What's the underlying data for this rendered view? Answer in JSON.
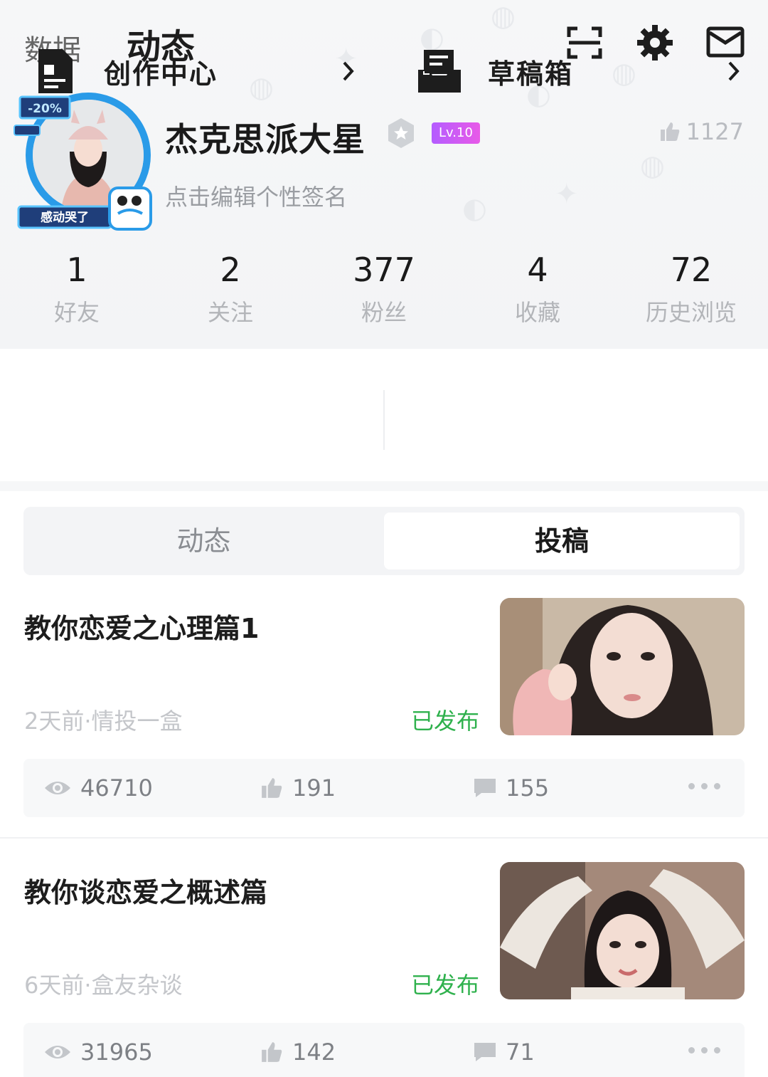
{
  "header": {
    "tab_data": "数据",
    "tab_dynamic": "动态",
    "icons": [
      "scan-icon",
      "settings-icon",
      "mail-icon"
    ]
  },
  "profile": {
    "avatar_badge_top": "-20%",
    "avatar_badge_bottom": "感动哭了",
    "username": "杰克思派大星",
    "level": "Lv.10",
    "likes_total": "1127",
    "signature": "点击编辑个性签名"
  },
  "stats": [
    {
      "value": "1",
      "label": "好友"
    },
    {
      "value": "2",
      "label": "关注"
    },
    {
      "value": "377",
      "label": "粉丝"
    },
    {
      "value": "4",
      "label": "收藏"
    },
    {
      "value": "72",
      "label": "历史浏览"
    }
  ],
  "quick_links": {
    "creation_center": "创作中心",
    "drafts": "草稿箱"
  },
  "content_tabs": {
    "dynamic": "动态",
    "submissions": "投稿",
    "active": "投稿"
  },
  "posts": [
    {
      "title": "教你恋爱之心理篇1",
      "meta": "2天前·情投一盒",
      "status": "已发布",
      "views": "46710",
      "likes": "191",
      "comments": "155"
    },
    {
      "title": "教你谈恋爱之概述篇",
      "meta": "6天前·盒友杂谈",
      "status": "已发布",
      "views": "31965",
      "likes": "142",
      "comments": "71"
    }
  ],
  "colors": {
    "published_green": "#2fb14d",
    "level_badge": "#c65cf0",
    "avatar_ring": "#2a9be8"
  }
}
